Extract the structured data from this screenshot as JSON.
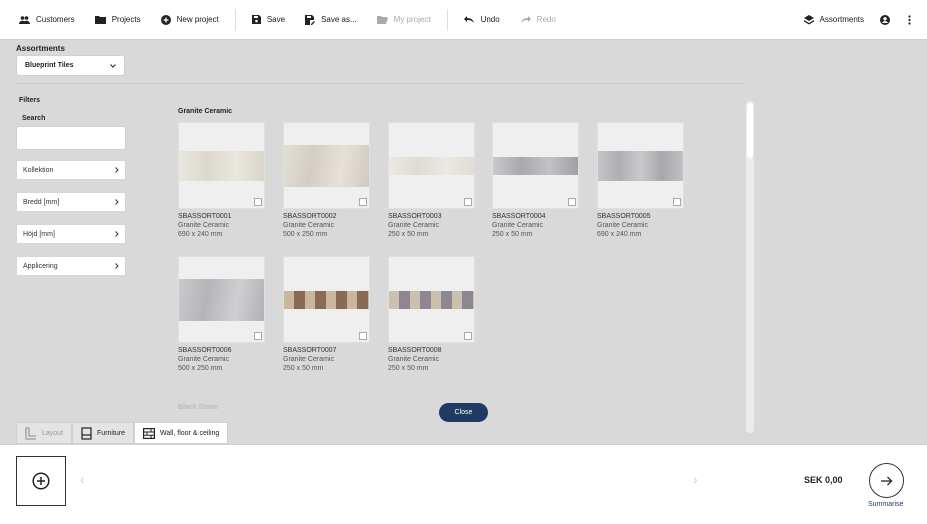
{
  "toolbar": {
    "customers": "Customers",
    "projects": "Projects",
    "new_project": "New project",
    "save": "Save",
    "save_as": "Save as...",
    "my_project": "My project",
    "undo": "Undo",
    "redo": "Redo",
    "assortments": "Assortments"
  },
  "sidebar": {
    "assortments_label": "Assortments",
    "assortment_value": "Blueprint Tiles",
    "filters_label": "Filters",
    "search_label": "Search",
    "search_value": "",
    "filters": [
      "Kollektion",
      "Bredd [mm]",
      "Höjd [mm]",
      "Applicering"
    ]
  },
  "catalog": {
    "section": "Granite Ceramic",
    "next_section": "Black Stone",
    "tiles": [
      {
        "code": "SBASSORT0001",
        "collection": "Granite Ceramic",
        "size": "690 x 240 mm"
      },
      {
        "code": "SBASSORT0002",
        "collection": "Granite Ceramic",
        "size": "500 x 250 mm"
      },
      {
        "code": "SBASSORT0003",
        "collection": "Granite Ceramic",
        "size": "250 x 50 mm"
      },
      {
        "code": "SBASSORT0004",
        "collection": "Granite Ceramic",
        "size": "250 x 50 mm"
      },
      {
        "code": "SBASSORT0005",
        "collection": "Granite Ceramic",
        "size": "690 x 240 mm"
      },
      {
        "code": "SBASSORT0006",
        "collection": "Granite Ceramic",
        "size": "500 x 250 mm"
      },
      {
        "code": "SBASSORT0007",
        "collection": "Granite Ceramic",
        "size": "250 x 50 mm"
      },
      {
        "code": "SBASSORT0008",
        "collection": "Granite Ceramic",
        "size": "250 x 50 mm"
      }
    ],
    "close": "Close"
  },
  "tabs": [
    "Layout",
    "Furniture",
    "Wall, floor & ceiling"
  ],
  "footer": {
    "price": "SEK 0,00",
    "summarise": "Summarise"
  },
  "colors": {
    "accent": "#1f3a63"
  }
}
